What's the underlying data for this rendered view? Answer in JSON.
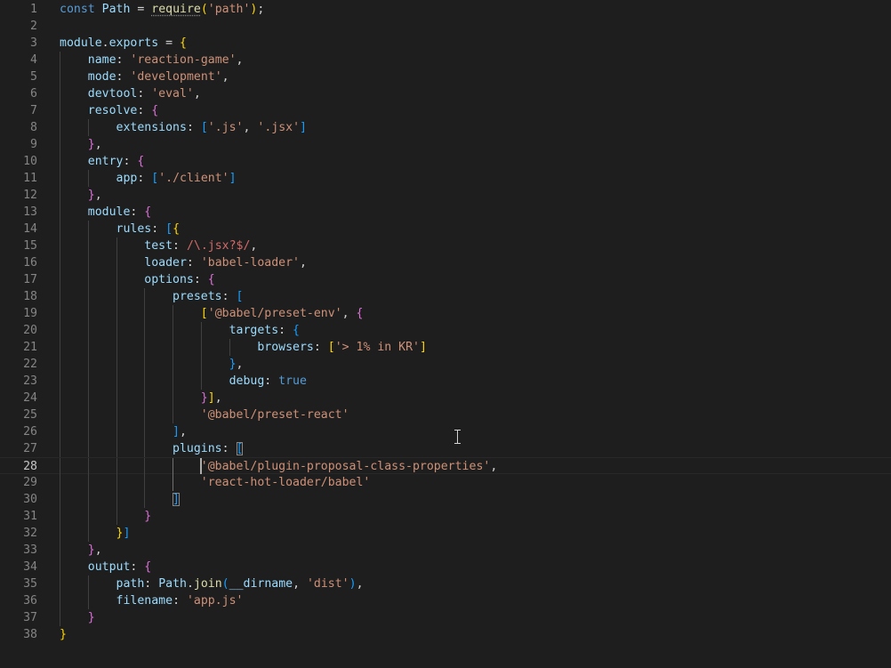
{
  "editor": {
    "language": "javascript",
    "active_line": 28,
    "lines": [
      {
        "n": "1",
        "tokens": [
          [
            "const",
            "tok-keyword"
          ],
          [
            " ",
            ""
          ],
          [
            "Path",
            "tok-var"
          ],
          [
            " = ",
            "tok-punct"
          ],
          [
            "require",
            "tok-func squiggle"
          ],
          [
            "(",
            "b1"
          ],
          [
            "'path'",
            "tok-str"
          ],
          [
            ")",
            "b1"
          ],
          [
            ";",
            "tok-punct"
          ]
        ]
      },
      {
        "n": "2",
        "tokens": []
      },
      {
        "n": "3",
        "tokens": [
          [
            "module",
            "tok-var"
          ],
          [
            ".",
            "tok-punct"
          ],
          [
            "exports",
            "tok-var"
          ],
          [
            " = ",
            "tok-punct"
          ],
          [
            "{",
            "b1"
          ]
        ]
      },
      {
        "n": "4",
        "tokens": [
          [
            "    ",
            ""
          ],
          [
            "name",
            "tok-prop"
          ],
          [
            ": ",
            "tok-punct"
          ],
          [
            "'reaction-game'",
            "tok-str"
          ],
          [
            ",",
            "tok-punct"
          ]
        ]
      },
      {
        "n": "5",
        "tokens": [
          [
            "    ",
            ""
          ],
          [
            "mode",
            "tok-prop"
          ],
          [
            ": ",
            "tok-punct"
          ],
          [
            "'development'",
            "tok-str"
          ],
          [
            ",",
            "tok-punct"
          ]
        ]
      },
      {
        "n": "6",
        "tokens": [
          [
            "    ",
            ""
          ],
          [
            "devtool",
            "tok-prop"
          ],
          [
            ": ",
            "tok-punct"
          ],
          [
            "'eval'",
            "tok-str"
          ],
          [
            ",",
            "tok-punct"
          ]
        ]
      },
      {
        "n": "7",
        "tokens": [
          [
            "    ",
            ""
          ],
          [
            "resolve",
            "tok-prop"
          ],
          [
            ": ",
            "tok-punct"
          ],
          [
            "{",
            "b2"
          ]
        ]
      },
      {
        "n": "8",
        "tokens": [
          [
            "        ",
            ""
          ],
          [
            "extensions",
            "tok-prop"
          ],
          [
            ": ",
            "tok-punct"
          ],
          [
            "[",
            "b3"
          ],
          [
            "'.js'",
            "tok-str"
          ],
          [
            ", ",
            "tok-punct"
          ],
          [
            "'.jsx'",
            "tok-str"
          ],
          [
            "]",
            "b3"
          ]
        ]
      },
      {
        "n": "9",
        "tokens": [
          [
            "    ",
            ""
          ],
          [
            "}",
            "b2"
          ],
          [
            ",",
            "tok-punct"
          ]
        ]
      },
      {
        "n": "10",
        "tokens": [
          [
            "    ",
            ""
          ],
          [
            "entry",
            "tok-prop"
          ],
          [
            ": ",
            "tok-punct"
          ],
          [
            "{",
            "b2"
          ]
        ]
      },
      {
        "n": "11",
        "tokens": [
          [
            "        ",
            ""
          ],
          [
            "app",
            "tok-prop"
          ],
          [
            ": ",
            "tok-punct"
          ],
          [
            "[",
            "b3"
          ],
          [
            "'./client'",
            "tok-str"
          ],
          [
            "]",
            "b3"
          ]
        ]
      },
      {
        "n": "12",
        "tokens": [
          [
            "    ",
            ""
          ],
          [
            "}",
            "b2"
          ],
          [
            ",",
            "tok-punct"
          ]
        ]
      },
      {
        "n": "13",
        "tokens": [
          [
            "    ",
            ""
          ],
          [
            "module",
            "tok-prop"
          ],
          [
            ": ",
            "tok-punct"
          ],
          [
            "{",
            "b2"
          ]
        ]
      },
      {
        "n": "14",
        "tokens": [
          [
            "        ",
            ""
          ],
          [
            "rules",
            "tok-prop"
          ],
          [
            ": ",
            "tok-punct"
          ],
          [
            "[",
            "b3"
          ],
          [
            "{",
            "b1"
          ]
        ]
      },
      {
        "n": "15",
        "tokens": [
          [
            "            ",
            ""
          ],
          [
            "test",
            "tok-prop"
          ],
          [
            ": ",
            "tok-punct"
          ],
          [
            "/\\.jsx?$/",
            "tok-regex"
          ],
          [
            ",",
            "tok-punct"
          ]
        ]
      },
      {
        "n": "16",
        "tokens": [
          [
            "            ",
            ""
          ],
          [
            "loader",
            "tok-prop"
          ],
          [
            ": ",
            "tok-punct"
          ],
          [
            "'babel-loader'",
            "tok-str"
          ],
          [
            ",",
            "tok-punct"
          ]
        ]
      },
      {
        "n": "17",
        "tokens": [
          [
            "            ",
            ""
          ],
          [
            "options",
            "tok-prop"
          ],
          [
            ": ",
            "tok-punct"
          ],
          [
            "{",
            "b2"
          ]
        ]
      },
      {
        "n": "18",
        "tokens": [
          [
            "                ",
            ""
          ],
          [
            "presets",
            "tok-prop"
          ],
          [
            ": ",
            "tok-punct"
          ],
          [
            "[",
            "b3"
          ]
        ]
      },
      {
        "n": "19",
        "tokens": [
          [
            "                    ",
            ""
          ],
          [
            "[",
            "b1"
          ],
          [
            "'@babel/preset-env'",
            "tok-str"
          ],
          [
            ", ",
            "tok-punct"
          ],
          [
            "{",
            "b2"
          ]
        ]
      },
      {
        "n": "20",
        "tokens": [
          [
            "                        ",
            ""
          ],
          [
            "targets",
            "tok-prop"
          ],
          [
            ": ",
            "tok-punct"
          ],
          [
            "{",
            "b3"
          ]
        ]
      },
      {
        "n": "21",
        "tokens": [
          [
            "                            ",
            ""
          ],
          [
            "browsers",
            "tok-prop"
          ],
          [
            ": ",
            "tok-punct"
          ],
          [
            "[",
            "b1"
          ],
          [
            "'> 1% in KR'",
            "tok-str"
          ],
          [
            "]",
            "b1"
          ]
        ]
      },
      {
        "n": "22",
        "tokens": [
          [
            "                        ",
            ""
          ],
          [
            "}",
            "b3"
          ],
          [
            ",",
            "tok-punct"
          ]
        ]
      },
      {
        "n": "23",
        "tokens": [
          [
            "                        ",
            ""
          ],
          [
            "debug",
            "tok-prop"
          ],
          [
            ": ",
            "tok-punct"
          ],
          [
            "true",
            "tok-bool"
          ]
        ]
      },
      {
        "n": "24",
        "tokens": [
          [
            "                    ",
            ""
          ],
          [
            "}",
            "b2"
          ],
          [
            "]",
            "b1"
          ],
          [
            ",",
            "tok-punct"
          ]
        ]
      },
      {
        "n": "25",
        "tokens": [
          [
            "                    ",
            ""
          ],
          [
            "'@babel/preset-react'",
            "tok-str"
          ]
        ]
      },
      {
        "n": "26",
        "tokens": [
          [
            "                ",
            ""
          ],
          [
            "]",
            "b3"
          ],
          [
            ",",
            "tok-punct"
          ]
        ]
      },
      {
        "n": "27",
        "tokens": [
          [
            "                ",
            ""
          ],
          [
            "plugins",
            "tok-prop"
          ],
          [
            ": ",
            "tok-punct"
          ],
          [
            "[",
            "b3 bracket-match"
          ]
        ]
      },
      {
        "n": "28",
        "tokens": [
          [
            "                    ",
            ""
          ],
          [
            "'@babel/plugin-proposal-class-properties'",
            "tok-str"
          ],
          [
            ",",
            "tok-punct"
          ]
        ]
      },
      {
        "n": "29",
        "tokens": [
          [
            "                    ",
            ""
          ],
          [
            "'react-hot-loader/babel'",
            "tok-str"
          ]
        ]
      },
      {
        "n": "30",
        "tokens": [
          [
            "                ",
            ""
          ],
          [
            "]",
            "b3 bracket-match"
          ]
        ]
      },
      {
        "n": "31",
        "tokens": [
          [
            "            ",
            ""
          ],
          [
            "}",
            "b2"
          ]
        ]
      },
      {
        "n": "32",
        "tokens": [
          [
            "        ",
            ""
          ],
          [
            "}",
            "b1"
          ],
          [
            "]",
            "b3"
          ]
        ]
      },
      {
        "n": "33",
        "tokens": [
          [
            "    ",
            ""
          ],
          [
            "}",
            "b2"
          ],
          [
            ",",
            "tok-punct"
          ]
        ]
      },
      {
        "n": "34",
        "tokens": [
          [
            "    ",
            ""
          ],
          [
            "output",
            "tok-prop"
          ],
          [
            ": ",
            "tok-punct"
          ],
          [
            "{",
            "b2"
          ]
        ]
      },
      {
        "n": "35",
        "tokens": [
          [
            "        ",
            ""
          ],
          [
            "path",
            "tok-prop"
          ],
          [
            ": ",
            "tok-punct"
          ],
          [
            "Path",
            "tok-var"
          ],
          [
            ".",
            "tok-punct"
          ],
          [
            "join",
            "tok-func"
          ],
          [
            "(",
            "b3"
          ],
          [
            "__dirname",
            "tok-var"
          ],
          [
            ", ",
            "tok-punct"
          ],
          [
            "'dist'",
            "tok-str"
          ],
          [
            ")",
            "b3"
          ],
          [
            ",",
            "tok-punct"
          ]
        ]
      },
      {
        "n": "36",
        "tokens": [
          [
            "        ",
            ""
          ],
          [
            "filename",
            "tok-prop"
          ],
          [
            ": ",
            "tok-punct"
          ],
          [
            "'app.js'",
            "tok-str"
          ]
        ]
      },
      {
        "n": "37",
        "tokens": [
          [
            "    ",
            ""
          ],
          [
            "}",
            "b2"
          ]
        ]
      },
      {
        "n": "38",
        "tokens": [
          [
            "}",
            "b1"
          ]
        ]
      }
    ]
  }
}
